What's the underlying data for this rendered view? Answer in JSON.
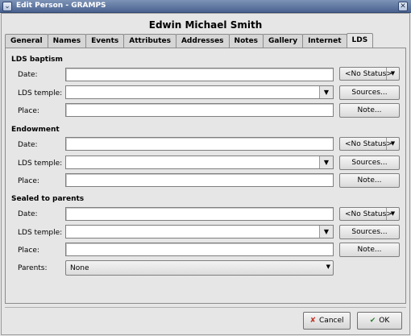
{
  "window": {
    "title": "Edit Person - GRAMPS",
    "menu_icon": "chevron-down-icon",
    "close_icon": "close-icon"
  },
  "person_name": "Edwin Michael Smith",
  "tabs": [
    {
      "label": "General",
      "active": false
    },
    {
      "label": "Names",
      "active": false
    },
    {
      "label": "Events",
      "active": false
    },
    {
      "label": "Attributes",
      "active": false
    },
    {
      "label": "Addresses",
      "active": false
    },
    {
      "label": "Notes",
      "active": false
    },
    {
      "label": "Gallery",
      "active": false
    },
    {
      "label": "Internet",
      "active": false
    },
    {
      "label": "LDS",
      "active": true
    }
  ],
  "sections": {
    "baptism": {
      "title": "LDS baptism",
      "date_label": "Date:",
      "temple_label": "LDS temple:",
      "place_label": "Place:",
      "date_value": "",
      "temple_value": "",
      "place_value": "",
      "status": "<No Status>",
      "sources_label": "Sources...",
      "note_label": "Note..."
    },
    "endowment": {
      "title": "Endowment",
      "date_label": "Date:",
      "temple_label": "LDS temple:",
      "place_label": "Place:",
      "date_value": "",
      "temple_value": "",
      "place_value": "",
      "status": "<No Status>",
      "sources_label": "Sources...",
      "note_label": "Note..."
    },
    "sealed": {
      "title": "Sealed to parents",
      "date_label": "Date:",
      "temple_label": "LDS temple:",
      "place_label": "Place:",
      "parents_label": "Parents:",
      "date_value": "",
      "temple_value": "",
      "place_value": "",
      "parents_value": "None",
      "status": "<No Status>",
      "sources_label": "Sources...",
      "note_label": "Note..."
    }
  },
  "footer": {
    "cancel_label": "Cancel",
    "ok_label": "OK"
  },
  "colors": {
    "titlebar": "#4a6290",
    "window_bg": "#e6e6e6"
  }
}
